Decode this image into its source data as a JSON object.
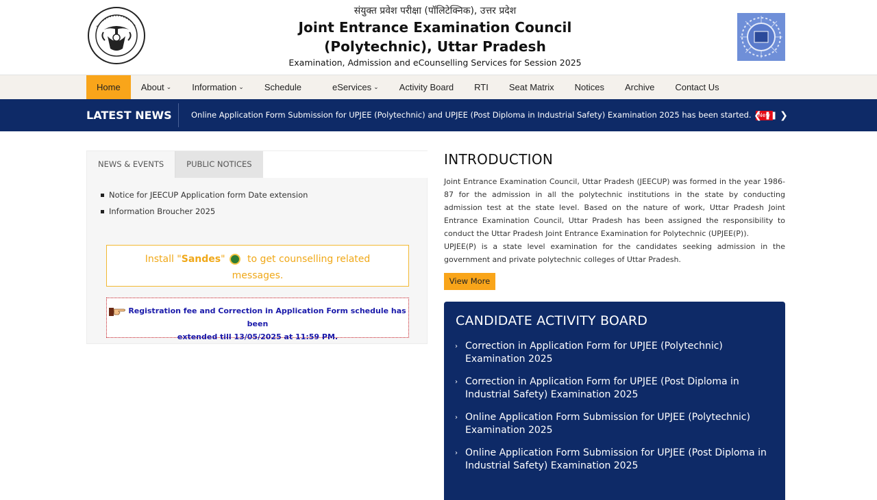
{
  "header": {
    "hindi_title": "संयुक्त प्रवेश परीक्षा (पॉलिटेक्निक), उत्तर प्रदेश",
    "title_line1": "Joint Entrance Examination Council",
    "title_line2": "(Polytechnic), Uttar Pradesh",
    "subtitle": "Examination, Admission and eCounselling Services for Session 2025",
    "left_logo": "up-government-emblem",
    "right_logo": "jeecup-logo"
  },
  "nav": {
    "items": [
      {
        "label": "Home",
        "active": true,
        "dropdown": false
      },
      {
        "label": "About",
        "active": false,
        "dropdown": true
      },
      {
        "label": "Information",
        "active": false,
        "dropdown": true
      },
      {
        "label": "Schedule",
        "active": false,
        "dropdown": false
      },
      {
        "label": "eServices",
        "active": false,
        "dropdown": true
      },
      {
        "label": "Activity Board",
        "active": false,
        "dropdown": false
      },
      {
        "label": "RTI",
        "active": false,
        "dropdown": false
      },
      {
        "label": "Seat Matrix",
        "active": false,
        "dropdown": false
      },
      {
        "label": "Notices",
        "active": false,
        "dropdown": false
      },
      {
        "label": "Archive",
        "active": false,
        "dropdown": false
      },
      {
        "label": "Contact Us",
        "active": false,
        "dropdown": false
      }
    ]
  },
  "ticker": {
    "label": "LATEST NEWS",
    "text": "Online Application Form Submission for UPJEE (Polytechnic) and UPJEE (Post Diploma in Industrial Safety) Examination 2025 has been started.",
    "badge": "New"
  },
  "left": {
    "tabs": [
      "NEWS & EVENTS",
      "PUBLIC NOTICES"
    ],
    "active_tab": "NEWS & EVENTS",
    "news": [
      "Notice for JEECUP Application form Date extension",
      "Information Broucher 2025"
    ],
    "sandes": {
      "prefix": "Install \"",
      "app": "Sandes",
      "suffix": "\"",
      "line1_end": " to get counselling related",
      "line2": "messages."
    },
    "registration": {
      "line1": "Registration fee and Correction in Application Form schedule has been",
      "line2": "extended till 13/05/2025 at 11:59 PM."
    }
  },
  "intro": {
    "title": "INTRODUCTION",
    "para1": "Joint Entrance Examination Council, Uttar Pradesh (JEECUP) was formed in the year 1986-87 for the admission in all the polytechnic institutions in the state by conducting admission test at the state level. Based on the nature of work, Uttar Pradesh Joint Entrance Examination Council, Uttar Pradesh has been assigned the responsibility to conduct the Uttar Pradesh Joint Entrance Examination for Polytechnic (UPJEE(P)).",
    "para2": "UPJEE(P) is a state level examination for the candidates seeking admission in the government and private polytechnic colleges of Uttar Pradesh.",
    "button": "View More"
  },
  "activity_board": {
    "title": "CANDIDATE ACTIVITY BOARD",
    "items": [
      {
        "line1": "Correction in Application Form for UPJEE (Polytechnic)",
        "line2": "Examination 2025"
      },
      {
        "line1": "Correction in Application Form for UPJEE (Post Diploma in",
        "line2": "Industrial Safety) Examination 2025"
      },
      {
        "line1": "Online Application Form Submission for UPJEE (Polytechnic)",
        "line2": "Examination 2025"
      },
      {
        "line1": "Online Application Form Submission for UPJEE (Post Diploma in",
        "line2": "Industrial Safety) Examination 2025"
      }
    ]
  },
  "colors": {
    "brand_navy": "#0e2a67",
    "accent_orange": "#f9a51a",
    "sandes_text": "#f0a818",
    "notice_blue": "#1a1aaa",
    "badge_red": "#e30b17"
  }
}
